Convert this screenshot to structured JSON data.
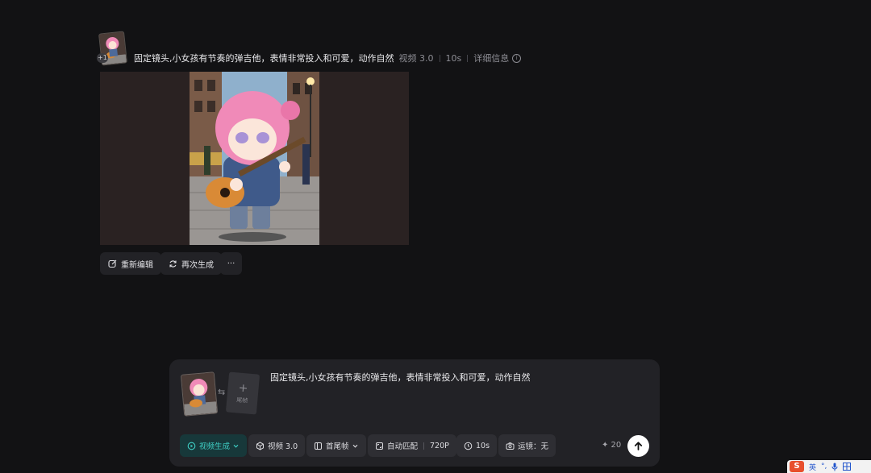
{
  "record": {
    "prompt": "固定镜头,小女孩有节奏的弹吉他，表情非常投入和可爱，动作自然",
    "model": "视频 3.0",
    "duration": "10s",
    "details_label": "详细信息",
    "badge": "+1"
  },
  "actions": {
    "re_edit": "重新编辑",
    "regenerate": "再次生成",
    "more": "···"
  },
  "composer": {
    "prompt": "固定镜头,小女孩有节奏的弹吉他，表情非常投入和可爱，动作自然",
    "end_frame_label": "尾帧",
    "end_frame_plus": "+",
    "swap_icon": "⇆",
    "mode": "视频生成",
    "model": "视频 3.0",
    "frame_mode": "首尾帧",
    "ratio": "自动匹配",
    "resolution": "720P",
    "duration": "10s",
    "camera": "运镜：无",
    "credits": "✦ 20",
    "accent_color": "#3fd0c6"
  },
  "ime": {
    "logo": "S",
    "lang": "英",
    "punct": "°,",
    "mic_icon": "mic-icon",
    "grid_icon": "keyboard-icon"
  }
}
